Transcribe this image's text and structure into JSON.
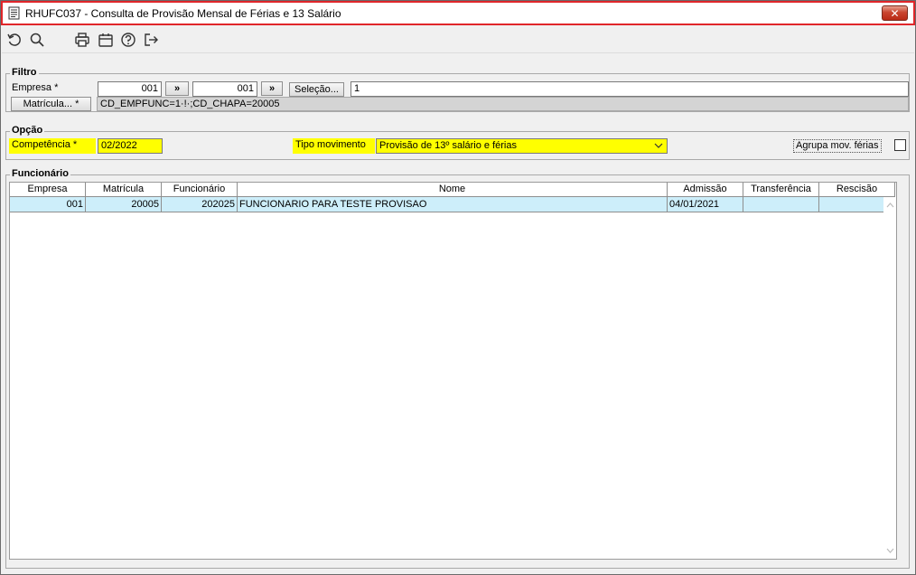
{
  "window": {
    "title": "RHUFC037 - Consulta de Provisão Mensal de Férias e 13 Salário",
    "close_symbol": "✕"
  },
  "toolbar": {
    "buttons": [
      {
        "icon": "refresh-icon"
      },
      {
        "icon": "search-icon"
      },
      {
        "icon": "print-icon"
      },
      {
        "icon": "calendar-icon"
      },
      {
        "icon": "help-icon"
      },
      {
        "icon": "exit-icon"
      }
    ]
  },
  "filtro": {
    "title": "Filtro",
    "empresa_label": "Empresa *",
    "empresa_from": "001",
    "empresa_to": "001",
    "range_button": "»",
    "range_button2": "»",
    "selecao_button": "Seleção...",
    "selecao_value": "1",
    "matricula_button": "Matrícula... *",
    "matricula_value": "CD_EMPFUNC=1·!·;CD_CHAPA=20005"
  },
  "opcao": {
    "title": "Opção",
    "competencia_label": "Competência *",
    "competencia_value": "02/2022",
    "tipo_label": "Tipo movimento",
    "tipo_value": "Provisão de 13º salário e férias",
    "agrupa_label": "Agrupa mov. férias",
    "agrupa_checked": false
  },
  "funcionario": {
    "title": "Funcionário",
    "columns": [
      "Empresa",
      "Matrícula",
      "Funcionário",
      "Nome",
      "Admissão",
      "Transferência",
      "Rescisão"
    ],
    "rows": [
      [
        "001",
        "20005",
        "202025",
        "FUNCIONARIO PARA TESTE PROVISAO",
        "04/01/2021",
        "",
        ""
      ]
    ]
  },
  "colors": {
    "title_border": "#e0262a",
    "highlight": "#ffff00",
    "selected_row": "#cdeefa"
  }
}
